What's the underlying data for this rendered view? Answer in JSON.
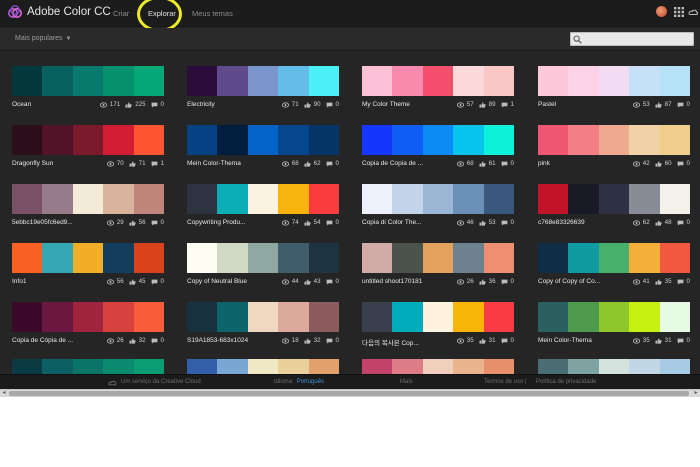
{
  "header": {
    "app_title": "Adobe Color CC",
    "nav": [
      {
        "label": "Criar",
        "active": false
      },
      {
        "label": "Explorar",
        "active": true
      },
      {
        "label": "Meus temas",
        "active": false
      }
    ],
    "icons": [
      "adobe-color-logo-icon",
      "avatar",
      "apps-grid-icon",
      "creative-cloud-icon"
    ]
  },
  "filter_bar": {
    "filter_label": "Mais populares",
    "search": {
      "placeholder": "",
      "value": ""
    }
  },
  "themes": [
    {
      "name": "Ocean",
      "views": "171",
      "likes": "225",
      "comments": "0",
      "colors": [
        "#03393d",
        "#07625f",
        "#08796d",
        "#05906e",
        "#06a877"
      ]
    },
    {
      "name": "Electricity",
      "views": "71",
      "likes": "90",
      "comments": "0",
      "colors": [
        "#2b0c3b",
        "#5f4a8c",
        "#7a95cc",
        "#63bde8",
        "#4af0f6"
      ]
    },
    {
      "name": "My Color Theme",
      "views": "57",
      "likes": "89",
      "comments": "1",
      "colors": [
        "#fcc0d6",
        "#f98aae",
        "#f44f6c",
        "#fbd9db",
        "#fac7c7"
      ]
    },
    {
      "name": "Pastel",
      "views": "53",
      "likes": "87",
      "comments": "0",
      "colors": [
        "#fdc8da",
        "#fdd2e7",
        "#f2dcf3",
        "#c6e0f8",
        "#b6e2f8"
      ]
    },
    {
      "name": "Dragonfly Sun",
      "views": "70",
      "likes": "71",
      "comments": "1",
      "colors": [
        "#2c0e1a",
        "#521328",
        "#7a1a2c",
        "#d21c34",
        "#fd552f"
      ]
    },
    {
      "name": "Mein Color-Thema",
      "views": "68",
      "likes": "62",
      "comments": "0",
      "colors": [
        "#064283",
        "#021e3e",
        "#0463c8",
        "#05478e",
        "#043468"
      ]
    },
    {
      "name": "Copia de Copia de ...",
      "views": "68",
      "likes": "61",
      "comments": "0",
      "colors": [
        "#1537fd",
        "#115ef6",
        "#0b8bf3",
        "#08c4ec",
        "#0df0da"
      ]
    },
    {
      "name": "pink",
      "views": "42",
      "likes": "60",
      "comments": "0",
      "colors": [
        "#ef5671",
        "#f27f85",
        "#efa98e",
        "#f1d1a6",
        "#f0ce8c"
      ]
    },
    {
      "name": "5ebbc19e05fc6ed9...",
      "views": "29",
      "likes": "56",
      "comments": "0",
      "colors": [
        "#7a5067",
        "#977b8b",
        "#f3ebd7",
        "#dab39c",
        "#c0857a"
      ]
    },
    {
      "name": "Copywriting Produ...",
      "views": "74",
      "likes": "54",
      "comments": "0",
      "colors": [
        "#2d3340",
        "#0aaeb4",
        "#fbf3df",
        "#f8b40d",
        "#fa3c3f"
      ]
    },
    {
      "name": "Copia di Color The...",
      "views": "46",
      "likes": "53",
      "comments": "0",
      "colors": [
        "#edf1fb",
        "#c3d4eb",
        "#9cb6d5",
        "#6b90b7",
        "#3a587d"
      ]
    },
    {
      "name": "c768e83326639",
      "views": "62",
      "likes": "48",
      "comments": "0",
      "colors": [
        "#c11429",
        "#181b26",
        "#2d3143",
        "#888c96",
        "#f4f1ea"
      ]
    },
    {
      "name": "Info1",
      "views": "56",
      "likes": "45",
      "comments": "0",
      "colors": [
        "#f86124",
        "#35a6b3",
        "#f3ae27",
        "#133c5d",
        "#d9431b"
      ]
    },
    {
      "name": "Copy of Neutral Blue",
      "views": "44",
      "likes": "43",
      "comments": "0",
      "colors": [
        "#fdfdf4",
        "#cfd9c3",
        "#8fa8a1",
        "#3f5d6b",
        "#1d3440"
      ]
    },
    {
      "name": "untitled shoot170181",
      "views": "26",
      "likes": "36",
      "comments": "0",
      "colors": [
        "#d2aaa6",
        "#4b544c",
        "#e4a15b",
        "#6e818f",
        "#ee8f72"
      ]
    },
    {
      "name": "Copy of Copy of Co...",
      "views": "41",
      "likes": "35",
      "comments": "0",
      "colors": [
        "#0e2d46",
        "#109aa2",
        "#47b16c",
        "#f4ae3a",
        "#f2573f"
      ]
    },
    {
      "name": "Copia de Cópia de ...",
      "views": "26",
      "likes": "32",
      "comments": "0",
      "colors": [
        "#3b0a2a",
        "#6b1840",
        "#a0243e",
        "#d7423f",
        "#f75d3a"
      ]
    },
    {
      "name": "S19A1853-683x1024",
      "views": "18",
      "likes": "32",
      "comments": "0",
      "colors": [
        "#17313f",
        "#0d656b",
        "#efd7c2",
        "#dea99d",
        "#8b5b5d"
      ]
    },
    {
      "name": "다음의 복사본 Cop...",
      "views": "35",
      "likes": "31",
      "comments": "0",
      "colors": [
        "#3a3f4d",
        "#00aebb",
        "#fff3e0",
        "#f9b507",
        "#f93c43"
      ]
    },
    {
      "name": "Mein Color-Thema",
      "views": "35",
      "likes": "31",
      "comments": "0",
      "colors": [
        "#2a6160",
        "#4e9b4d",
        "#8ec62c",
        "#c6f012",
        "#e6fae3"
      ]
    },
    {
      "name": "",
      "views": "",
      "likes": "",
      "comments": "",
      "colors": [
        "#0a3a44",
        "#0c5f63",
        "#097569",
        "#0a8a6e",
        "#0a9d73"
      ]
    },
    {
      "name": "",
      "views": "",
      "likes": "",
      "comments": "",
      "colors": [
        "#335fa8",
        "#7aa6d4",
        "#f1e9c6",
        "#ead09a",
        "#e2a06c"
      ]
    },
    {
      "name": "",
      "views": "",
      "likes": "",
      "comments": "",
      "colors": [
        "#c2426a",
        "#dd7b86",
        "#f0d0bd",
        "#e9b48e",
        "#e88f6b"
      ]
    },
    {
      "name": "",
      "views": "",
      "likes": "",
      "comments": "",
      "colors": [
        "#4a6d74",
        "#7fa3a3",
        "#d4e3dd",
        "#c1d7e6",
        "#a7cbe4"
      ]
    }
  ],
  "footer": {
    "service": "Um serviço da Creative Cloud",
    "language_label": "Idioma:",
    "language_value": "Português",
    "more": "Mais",
    "terms": "Termos de uso",
    "separator": "|",
    "privacy": "Política de privacidade"
  }
}
